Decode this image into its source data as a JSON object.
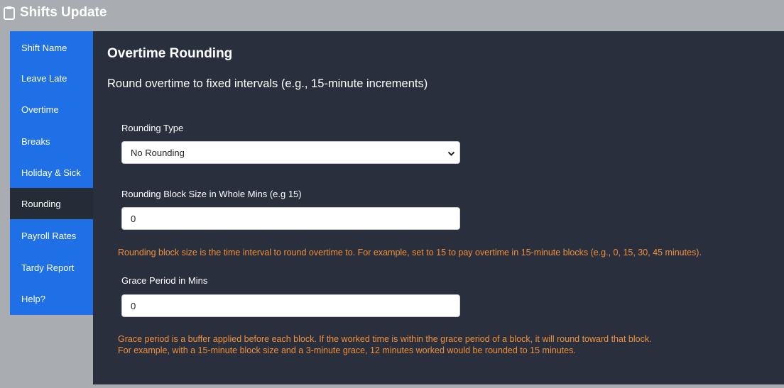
{
  "header": {
    "title": "Shifts Update",
    "icon": "clipboard-icon"
  },
  "sidebar": {
    "items": [
      {
        "label": "Shift Name"
      },
      {
        "label": "Leave Late"
      },
      {
        "label": "Overtime"
      },
      {
        "label": "Breaks"
      },
      {
        "label": "Holiday & Sick"
      },
      {
        "label": "Rounding"
      },
      {
        "label": "Payroll Rates"
      },
      {
        "label": "Tardy Report"
      },
      {
        "label": "Help?"
      }
    ],
    "active": "Rounding"
  },
  "main": {
    "title": "Overtime Rounding",
    "subtitle": "Round overtime to fixed intervals (e.g., 15-minute increments)",
    "rounding_type": {
      "label": "Rounding Type",
      "value": "No Rounding"
    },
    "block_size": {
      "label": "Rounding Block Size in Whole Mins (e.g 15)",
      "value": "0",
      "note": "Rounding block size is the time interval to round overtime to. For example, set to 15 to pay overtime in 15-minute blocks (e.g., 0, 15, 30, 45 minutes)."
    },
    "grace": {
      "label": "Grace Period in Mins",
      "value": "0",
      "note_line1": "Grace period is a buffer applied before each block. If the worked time is within the grace period of a block, it will round toward that block.",
      "note_line2": "For example, with a 15-minute block size and a 3-minute grace, 12 minutes worked would be rounded to 15 minutes."
    }
  },
  "colors": {
    "background": "#a9acb0",
    "sidebar": "#1f6fe6",
    "active_item": "#262b38",
    "panel": "#2a2f3e",
    "note": "#f0903a"
  }
}
